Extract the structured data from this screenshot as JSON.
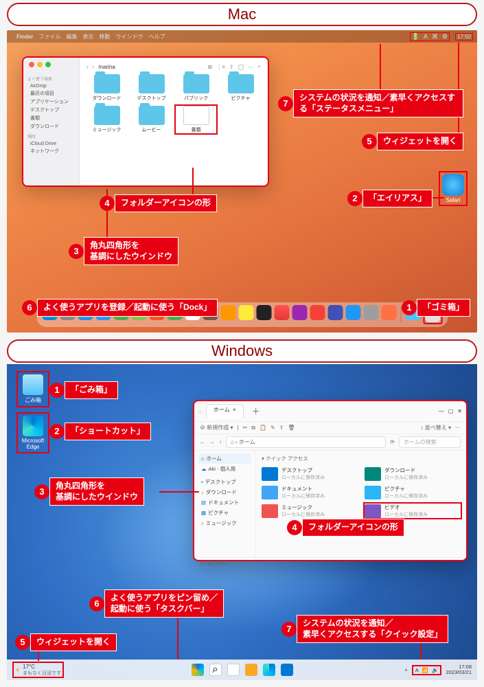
{
  "sections": {
    "mac": "Mac",
    "windows": "Windows"
  },
  "mac": {
    "menubar": {
      "apple": "",
      "app": "Finder",
      "items": [
        "ファイル",
        "編集",
        "表示",
        "移動",
        "ウインドウ",
        "ヘルプ"
      ],
      "time": "17:50"
    },
    "finder": {
      "title": "marina",
      "search_placeholder": "検索",
      "sidebar_groups": [
        {
          "label": "よく使う項目",
          "items": [
            "AirDrop",
            "最近の項目",
            "アプリケーション",
            "デスクトップ",
            "書類",
            "ダウンロード"
          ]
        },
        {
          "label": "場所",
          "items": [
            "iCloud Drive",
            "ネットワーク"
          ]
        }
      ],
      "folders": [
        "ダウンロード",
        "デスクトップ",
        "パブリック",
        "ピクチャ",
        "ミュージック",
        "ムービー",
        "書類"
      ]
    },
    "alias_label": "Safari",
    "dock_apps": [
      "Finder",
      "Launchpad",
      "Safari",
      "Mail",
      "Messages",
      "Maps",
      "Photos",
      "FaceTime",
      "Calendar",
      "Contacts",
      "Reminders",
      "Notes",
      "Freeform",
      "TV",
      "Music",
      "Podcasts",
      "News",
      "Keynote",
      "AppStore",
      "Settings",
      "Xcode",
      "Folder",
      "Trash"
    ],
    "callouts": {
      "c1": "「ゴミ箱」",
      "c2": "「エイリアス」",
      "c3": "角丸四角形を\n基調にしたウインドウ",
      "c4": "フォルダーアイコンの形",
      "c5": "ウィジェットを開く",
      "c6": "よく使うアプリを登録／起動に使う「Dock」",
      "c7": "システムの状況を通知／素早くアクセスする「ステータスメニュー」"
    }
  },
  "windows": {
    "desktop_icons": {
      "recycle": "ごみ箱",
      "edge": "Microsoft Edge"
    },
    "explorer": {
      "tab_title": "ホーム",
      "toolbar": {
        "new": "新規作成",
        "sort": "並べ替え"
      },
      "path": "ホーム",
      "search_placeholder": "ホームの検索",
      "sidebar": [
        "ホーム",
        "Aki - 個人用",
        "デスクトップ",
        "ダウンロード",
        "ドキュメント",
        "ピクチャ",
        "ミュージック"
      ],
      "section_label": "クイック アクセス",
      "quick_access": [
        {
          "name": "デスクトップ",
          "sub": "ローカルに保存済み"
        },
        {
          "name": "ダウンロード",
          "sub": "ローカルに保存済み"
        },
        {
          "name": "ドキュメント",
          "sub": "ローカルに保存済み"
        },
        {
          "name": "ピクチャ",
          "sub": "ローカルに保存済み"
        },
        {
          "name": "ミュージック",
          "sub": "ローカルに保存済み"
        },
        {
          "name": "ビデオ",
          "sub": "ローカルに保存済み"
        }
      ],
      "status": "31 個の項目"
    },
    "taskbar": {
      "weather_temp": "17°C",
      "weather_text": "まもなく日没です",
      "time": "17:08",
      "date": "2023/03/21"
    },
    "callouts": {
      "c1": "「ごみ箱」",
      "c2": "「ショートカット」",
      "c3": "角丸四角形を\n基調にしたウインドウ",
      "c4": "フォルダーアイコンの形",
      "c5": "ウィジェットを開く",
      "c6": "よく使うアプリをピン留め／\n起動に使う「タスクバー」",
      "c7": "システムの状況を通知／\n素早くアクセスする「クイック設定」"
    }
  }
}
